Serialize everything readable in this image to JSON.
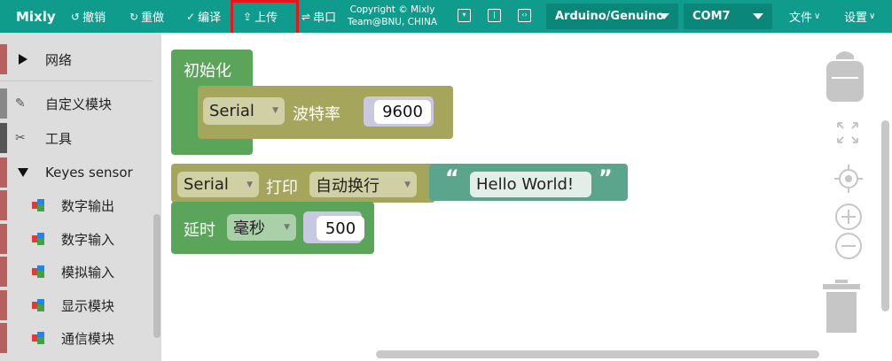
{
  "topbar": {
    "brand": "Mixly",
    "undo": "撤销",
    "redo": "重做",
    "compile": "编译",
    "upload": "上传",
    "serial": "串口",
    "copyright_line1": "Copyright © Mixly",
    "copyright_line2": "Team@BNU, CHINA",
    "board": "Arduino/Genuino",
    "port": "COM7",
    "file_menu": "文件",
    "settings_menu": "设置"
  },
  "sidebar": {
    "items": [
      {
        "label": "网络"
      },
      {
        "label": "自定义模块"
      },
      {
        "label": "工具"
      },
      {
        "label": "Keyes sensor"
      },
      {
        "label": "数字输出"
      },
      {
        "label": "数字输入"
      },
      {
        "label": "模拟输入"
      },
      {
        "label": "显示模块"
      },
      {
        "label": "通信模块"
      }
    ]
  },
  "blocks": {
    "setup_label": "初始化",
    "serial1": "Serial",
    "baud_label": "波特率",
    "baud_value": "9600",
    "serial2": "Serial",
    "print_label": "打印",
    "newline_option": "自动换行",
    "quote_open": "“",
    "hello": "Hello World!",
    "quote_close": "”",
    "delay_label": "延时",
    "ms_option": "毫秒",
    "delay_value": "500"
  },
  "colors": {
    "topbar": "#0f9c8c",
    "highlight": "#e8161b",
    "block_green": "#5ba55b",
    "block_olive": "#a5a55c",
    "block_teal": "#5ba58c"
  }
}
